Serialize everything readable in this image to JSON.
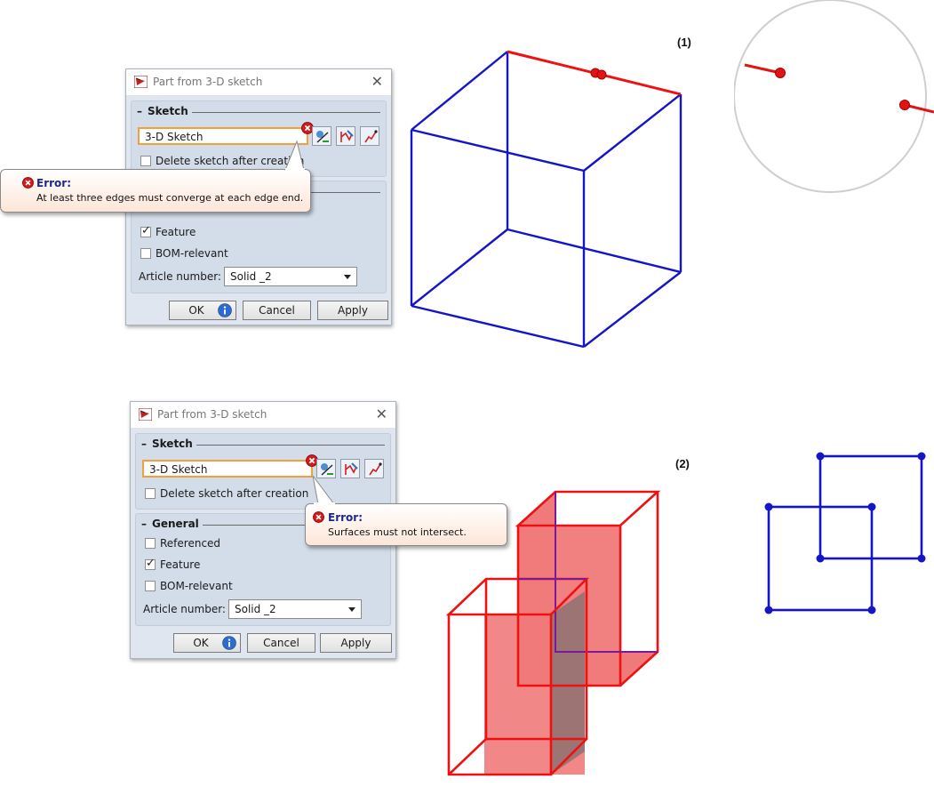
{
  "annotations": {
    "label1": "(1)",
    "label2": "(2)"
  },
  "dialog1": {
    "title": "Part from 3-D sketch",
    "sketch_section": "Sketch",
    "sketch_field": "3-D Sketch",
    "delete_checkbox": "Delete sketch after creation",
    "feature_checkbox": "Feature",
    "bom_checkbox": "BOM-relevant",
    "article_label": "Article number:",
    "article_value": "Solid _2",
    "ok": "OK",
    "cancel": "Cancel",
    "apply": "Apply"
  },
  "tooltip1": {
    "title": "Error:",
    "message": "At least three edges must converge at each edge end."
  },
  "dialog2": {
    "title": "Part from 3-D sketch",
    "sketch_section": "Sketch",
    "sketch_field": "3-D Sketch",
    "delete_checkbox": "Delete sketch after creation",
    "general_section": "General",
    "referenced_checkbox": "Referenced",
    "feature_checkbox": "Feature",
    "bom_checkbox": "BOM-relevant",
    "article_label": "Article number:",
    "article_value": "Solid _2",
    "ok": "OK",
    "cancel": "Cancel",
    "apply": "Apply"
  },
  "tooltip2": {
    "title": "Error:",
    "message": "Surfaces must not intersect."
  },
  "colors": {
    "edge_blue": "#1515c8",
    "edge_red": "#ee1111",
    "face_red": "#f07a7a",
    "accent_orange": "#f2a03c",
    "error_title": "#1a2a8c"
  },
  "icons": {
    "app": "hicad-app-icon",
    "close": "close-icon",
    "error": "error-badge-icon",
    "info": "info-icon",
    "tools": [
      "sketch-pick-icon",
      "sketch-edit-icon",
      "sketch-curve-icon"
    ]
  }
}
